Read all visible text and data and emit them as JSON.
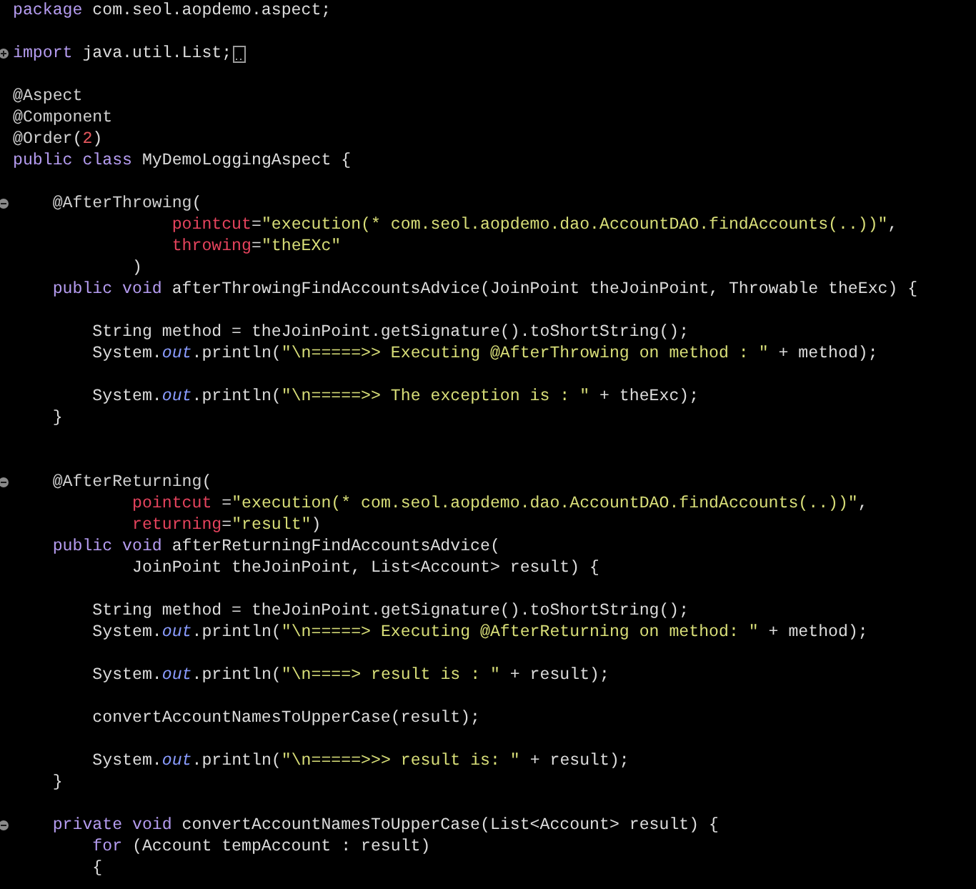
{
  "editor": {
    "lines": [
      {
        "kind": "code",
        "tokens": [
          {
            "kind": "kw",
            "text": "package"
          },
          {
            "kind": "p",
            "text": " com.seol.aopdemo.aspect;"
          }
        ]
      },
      {
        "kind": "blank"
      },
      {
        "kind": "fold",
        "collapsed": true,
        "tokens": [
          {
            "kind": "kw",
            "text": "import"
          },
          {
            "kind": "p",
            "text": " java.util.List;"
          }
        ]
      },
      {
        "kind": "blank"
      },
      {
        "kind": "code",
        "tokens": [
          {
            "kind": "an",
            "text": "@Aspect"
          }
        ]
      },
      {
        "kind": "code",
        "tokens": [
          {
            "kind": "an",
            "text": "@Component"
          }
        ]
      },
      {
        "kind": "code",
        "tokens": [
          {
            "kind": "an",
            "text": "@Order"
          },
          {
            "kind": "p",
            "text": "("
          },
          {
            "kind": "n",
            "text": "2"
          },
          {
            "kind": "p",
            "text": ")"
          }
        ]
      },
      {
        "kind": "code",
        "tokens": [
          {
            "kind": "kw",
            "text": "public class"
          },
          {
            "kind": "p",
            "text": " MyDemoLoggingAspect {"
          }
        ]
      },
      {
        "kind": "blank"
      },
      {
        "kind": "fold",
        "collapsed": false,
        "tokens": [
          {
            "kind": "an",
            "text": "    @AfterThrowing"
          },
          {
            "kind": "p",
            "text": "("
          }
        ]
      },
      {
        "kind": "code",
        "tokens": [
          {
            "kind": "at",
            "text": "                pointcut"
          },
          {
            "kind": "p",
            "text": "="
          },
          {
            "kind": "s",
            "text": "\"execution(* com.seol.aopdemo.dao.AccountDAO.findAccounts(..))\""
          },
          {
            "kind": "p",
            "text": ","
          }
        ]
      },
      {
        "kind": "code",
        "tokens": [
          {
            "kind": "at",
            "text": "                throwing"
          },
          {
            "kind": "p",
            "text": "="
          },
          {
            "kind": "s",
            "text": "\"theEXc\""
          }
        ]
      },
      {
        "kind": "code",
        "tokens": [
          {
            "kind": "p",
            "text": "            )"
          }
        ]
      },
      {
        "kind": "code",
        "tokens": [
          {
            "kind": "kw",
            "text": "    public void"
          },
          {
            "kind": "p",
            "text": " afterThrowingFindAccountsAdvice(JoinPoint theJoinPoint, Throwable theExc) {"
          }
        ]
      },
      {
        "kind": "blank"
      },
      {
        "kind": "code",
        "tokens": [
          {
            "kind": "p",
            "text": "        String method = theJoinPoint.getSignature().toShortString();"
          }
        ]
      },
      {
        "kind": "code",
        "tokens": [
          {
            "kind": "p",
            "text": "        System."
          },
          {
            "kind": "f",
            "text": "out"
          },
          {
            "kind": "p",
            "text": ".println("
          },
          {
            "kind": "s",
            "text": "\"\\n=====>> Executing @AfterThrowing on method : \""
          },
          {
            "kind": "p",
            "text": " + method);"
          }
        ]
      },
      {
        "kind": "blank"
      },
      {
        "kind": "code",
        "tokens": [
          {
            "kind": "p",
            "text": "        System."
          },
          {
            "kind": "f",
            "text": "out"
          },
          {
            "kind": "p",
            "text": ".println("
          },
          {
            "kind": "s",
            "text": "\"\\n=====>> The exception is : \""
          },
          {
            "kind": "p",
            "text": " + theExc);"
          }
        ]
      },
      {
        "kind": "code",
        "tokens": [
          {
            "kind": "p",
            "text": "    }"
          }
        ]
      },
      {
        "kind": "blank"
      },
      {
        "kind": "blank"
      },
      {
        "kind": "fold",
        "collapsed": false,
        "tokens": [
          {
            "kind": "an",
            "text": "    @AfterReturning"
          },
          {
            "kind": "p",
            "text": "("
          }
        ]
      },
      {
        "kind": "code",
        "tokens": [
          {
            "kind": "at",
            "text": "            pointcut"
          },
          {
            "kind": "p",
            "text": " ="
          },
          {
            "kind": "s",
            "text": "\"execution(* com.seol.aopdemo.dao.AccountDAO.findAccounts(..))\""
          },
          {
            "kind": "p",
            "text": ","
          }
        ]
      },
      {
        "kind": "code",
        "tokens": [
          {
            "kind": "at",
            "text": "            returning"
          },
          {
            "kind": "p",
            "text": "="
          },
          {
            "kind": "s",
            "text": "\"result\""
          },
          {
            "kind": "p",
            "text": ")"
          }
        ]
      },
      {
        "kind": "code",
        "tokens": [
          {
            "kind": "kw",
            "text": "    public void"
          },
          {
            "kind": "p",
            "text": " afterReturningFindAccountsAdvice("
          }
        ]
      },
      {
        "kind": "code",
        "tokens": [
          {
            "kind": "p",
            "text": "            JoinPoint theJoinPoint, List<Account> result) {"
          }
        ]
      },
      {
        "kind": "blank"
      },
      {
        "kind": "code",
        "tokens": [
          {
            "kind": "p",
            "text": "        String method = theJoinPoint.getSignature().toShortString();"
          }
        ]
      },
      {
        "kind": "code",
        "tokens": [
          {
            "kind": "p",
            "text": "        System."
          },
          {
            "kind": "f",
            "text": "out"
          },
          {
            "kind": "p",
            "text": ".println("
          },
          {
            "kind": "s",
            "text": "\"\\n=====> Executing @AfterReturning on method: \""
          },
          {
            "kind": "p",
            "text": " + method);"
          }
        ]
      },
      {
        "kind": "blank"
      },
      {
        "kind": "code",
        "tokens": [
          {
            "kind": "p",
            "text": "        System."
          },
          {
            "kind": "f",
            "text": "out"
          },
          {
            "kind": "p",
            "text": ".println("
          },
          {
            "kind": "s",
            "text": "\"\\n====> result is : \""
          },
          {
            "kind": "p",
            "text": " + result);"
          }
        ]
      },
      {
        "kind": "blank"
      },
      {
        "kind": "code",
        "tokens": [
          {
            "kind": "p",
            "text": "        convertAccountNamesToUpperCase(result);"
          }
        ]
      },
      {
        "kind": "blank"
      },
      {
        "kind": "code",
        "tokens": [
          {
            "kind": "p",
            "text": "        System."
          },
          {
            "kind": "f",
            "text": "out"
          },
          {
            "kind": "p",
            "text": ".println("
          },
          {
            "kind": "s",
            "text": "\"\\n=====>>> result is: \""
          },
          {
            "kind": "p",
            "text": " + result);"
          }
        ]
      },
      {
        "kind": "code",
        "tokens": [
          {
            "kind": "p",
            "text": "    }"
          }
        ]
      },
      {
        "kind": "blank"
      },
      {
        "kind": "fold",
        "collapsed": false,
        "tokens": [
          {
            "kind": "kw",
            "text": "    private void"
          },
          {
            "kind": "p",
            "text": " convertAccountNamesToUpperCase(List<Account> result) {"
          }
        ]
      },
      {
        "kind": "code",
        "tokens": [
          {
            "kind": "kw",
            "text": "        for"
          },
          {
            "kind": "p",
            "text": " (Account tempAccount : result)"
          }
        ]
      },
      {
        "kind": "code",
        "tokens": [
          {
            "kind": "p",
            "text": "        {"
          }
        ]
      }
    ]
  }
}
